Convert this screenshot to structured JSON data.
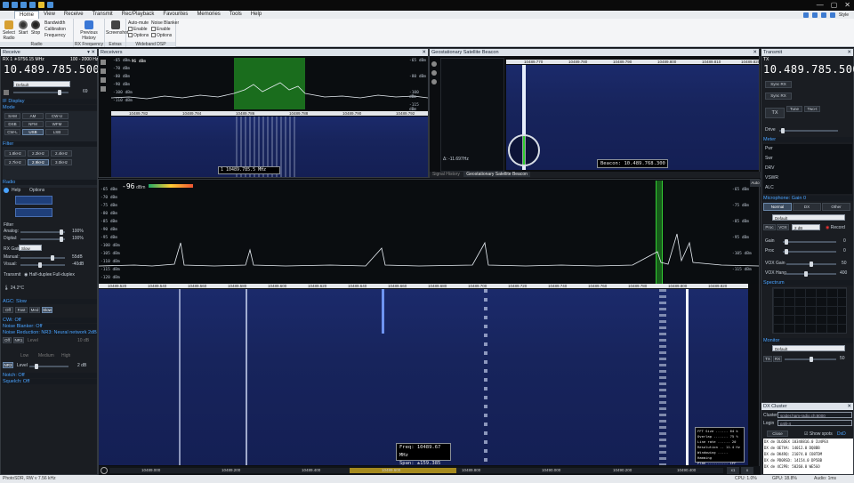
{
  "titlebar": {
    "window_controls": [
      "—",
      "▢",
      "✕"
    ]
  },
  "menu": {
    "items": [
      "Home",
      "View",
      "Receive",
      "Transmit",
      "Rec/Playback",
      "Favourites",
      "Memories",
      "Tools",
      "Help"
    ],
    "style_label": "Style"
  },
  "ribbon": {
    "radio": {
      "select_label": "Select Radio",
      "start_label": "Start",
      "stop_label": "Stop",
      "bandwidth": "Bandwidth",
      "calibration": "Calibration",
      "frequency": "Frequency",
      "group": "Radio"
    },
    "rxfreq": {
      "previous_history": "Previous History",
      "group": "RX Frequency"
    },
    "extras": {
      "screenshot": "Screenshot",
      "group": "Extras"
    },
    "wdsp": {
      "auto_mute": "Auto-mute",
      "noise_blanker": "Noise Blanker",
      "enable": "Enable",
      "options": "Options",
      "group": "Wideband DSP"
    }
  },
  "receive": {
    "title": "Receive",
    "rx_line": "RX 1  ☀9756.15 MHz",
    "freq_range": "100 - 2000 Hz",
    "frequency": "10.489.785.500",
    "preset": "Default",
    "vol_value": "69",
    "if_display": "IF Display",
    "mode_label": "Mode",
    "modes": [
      "AM",
      "SAM",
      "CW-U",
      "DSB",
      "NFM",
      "WFM",
      "CW-L",
      "USB",
      "LSB"
    ],
    "filter_label": "Filter",
    "filters": [
      "1.8kHz",
      "2.2kHz",
      "2.4kHz",
      "2.7kHz",
      "2.9kHz",
      "3.0kHz"
    ],
    "radio_label": "Radio",
    "help": "Help",
    "options": "Options",
    "filter_section": "Filter",
    "analog_label": "Analog:",
    "analog_value": "100%",
    "digital_label": "Digital:",
    "digital_value": "100%",
    "rx_gain_label": "RX Gain",
    "rx_gain_mode": "Slow Attack",
    "manual_label": "Manual:",
    "manual_value": "55dB",
    "visual_label": "Visual:",
    "visual_value": "-40dB",
    "transmit_label": "Transmit",
    "half_duplex": "Half-duplex",
    "full_duplex": "Full-duplex",
    "temp": "24.2°C",
    "agc_label": "AGC: Slow",
    "agc_modes": [
      "Off",
      "Fast",
      "Med",
      "Slow"
    ],
    "cwi": "CWi: Off",
    "nb": "Noise Blanker: Off",
    "nr": "Noise Reduction: NR3: Neural network 2dB",
    "nr_off": "Off",
    "nr1": "NR1",
    "level_label": "Level",
    "level_value": "10 dB",
    "nr3": "NR3",
    "low": "Low",
    "medium": "Medium",
    "high": "High",
    "nr3_level_value": "2 dB",
    "notch": "Notch: Off",
    "squelch": "Squelch: Off"
  },
  "receivers": {
    "title": "Receivers",
    "peak": "-96 dBm",
    "db_scale": [
      "-65 dBm",
      "-70 dBm",
      "-80 dBm",
      "-90 dBm",
      "-100 dBm",
      "-110 dBm",
      "-115 dBm"
    ],
    "ruler": [
      "10489.782",
      "10489.784",
      "10489.786",
      "10489.788",
      "10489.790",
      "10489.792"
    ],
    "readout": "1  10489.785.5 MHz"
  },
  "geo": {
    "title": "Geostationary Satellite Beacon",
    "ruler": [
      "10489.770",
      "10489.780",
      "10489.790",
      "10489.800",
      "10489.810",
      "10489.820"
    ],
    "beacon": "Beacon: 10.489.768.300",
    "delta": "Δ: -11.697Hz",
    "tab_signal_history": "Signal History",
    "tab_geo": "Geostationary Satellite Beacon"
  },
  "main": {
    "peak": "-96",
    "peak_unit": "dBm",
    "auto_label": "Auto",
    "db_scale": [
      "-65 dBm",
      "-70 dBm",
      "-75 dBm",
      "-80 dBm",
      "-85 dBm",
      "-90 dBm",
      "-95 dBm",
      "-100 dBm",
      "-105 dBm",
      "-110 dBm",
      "-115 dBm",
      "-120 dBm"
    ],
    "ruler": [
      "10489.520",
      "10489.540",
      "10489.560",
      "10489.580",
      "10489.600",
      "10489.620",
      "10489.640",
      "10489.660",
      "10489.680",
      "10489.700",
      "10489.720",
      "10489.740",
      "10489.760",
      "10489.780",
      "10489.800",
      "10489.820"
    ],
    "bottom_ruler": [
      "10489.000",
      "10489.200",
      "10489.400",
      "10489.600",
      "10489.800",
      "10490.000",
      "10490.200",
      "10490.400"
    ],
    "freq_label": "Freq: 10489.67 MHz",
    "span_label": "Span: ±159.385 kHz",
    "fft_info": [
      "FFT Size ...... 64 k",
      "Overlap ....... 75 %",
      "Line rate ...... 20",
      "Resolution .. 11.4 Hz",
      "Windowing ..... Hamming",
      "Plan .......... IFF"
    ],
    "zoom_labels": [
      "x1",
      "x"
    ]
  },
  "transmit": {
    "title": "Transmit",
    "tx_label": "TX",
    "frequency": "10.489.785.500",
    "sync_rx": "Sync RX",
    "sync_rx2": "Sync RX",
    "tx_button": "TX",
    "tune": "Tune",
    "two_tone": "Two-t",
    "drive_label": "Drive",
    "meter_label": "Meter",
    "meter_rows": [
      "Pwr",
      "Swr",
      "DRV",
      "VSWR",
      "ALC"
    ],
    "mic_label": "Microphone: Gain 0",
    "mic_tabs": [
      "Normal",
      "DX",
      "Other"
    ],
    "mic_preset": "Default",
    "proc_label": "Proc",
    "vox_label": "VOX",
    "vox_value": "2 dB",
    "record_label": "Record",
    "gain_label": "Gain",
    "gain_value": "0",
    "proc_value": "0",
    "vox_gain_label": "VOX Gain",
    "vox_gain_value": "50",
    "vox_hang_label": "VOX Hang",
    "vox_hang_value": "400",
    "spectrum_label": "Spectrum",
    "monitor_label": "Monitor",
    "monitor_preset": "Default",
    "tx_btn": "TX",
    "rx_btn": "RX",
    "monitor_value": "50"
  },
  "dx": {
    "title": "DX Cluster",
    "cluster_label": "Cluster",
    "cluster_value": "spider.ham-radio.ch:8000",
    "login_label": "Login",
    "login_value": "g4ili-4",
    "close_btn": "Close",
    "show_spots": "Show spots",
    "dxd": "DxD",
    "spots": [
      "DX de DL6DEX  10348816.0  IU4PEX",
      "DX de OE7VA:  14012.0     DQ8BB",
      "DX de DK4RQ:  21074.0     CO8TDM",
      "DX de PD0RSD:  14154.0    DP5BB",
      "DX de 4C2PB:  50260.0     WE5GO"
    ]
  },
  "status": {
    "left": "PhotoSDR, RW v 7.56 kHz",
    "cpu": "CPU: 1.0%",
    "gpu": "GPU: 18.8%",
    "audio": "Audio: 1ms"
  }
}
